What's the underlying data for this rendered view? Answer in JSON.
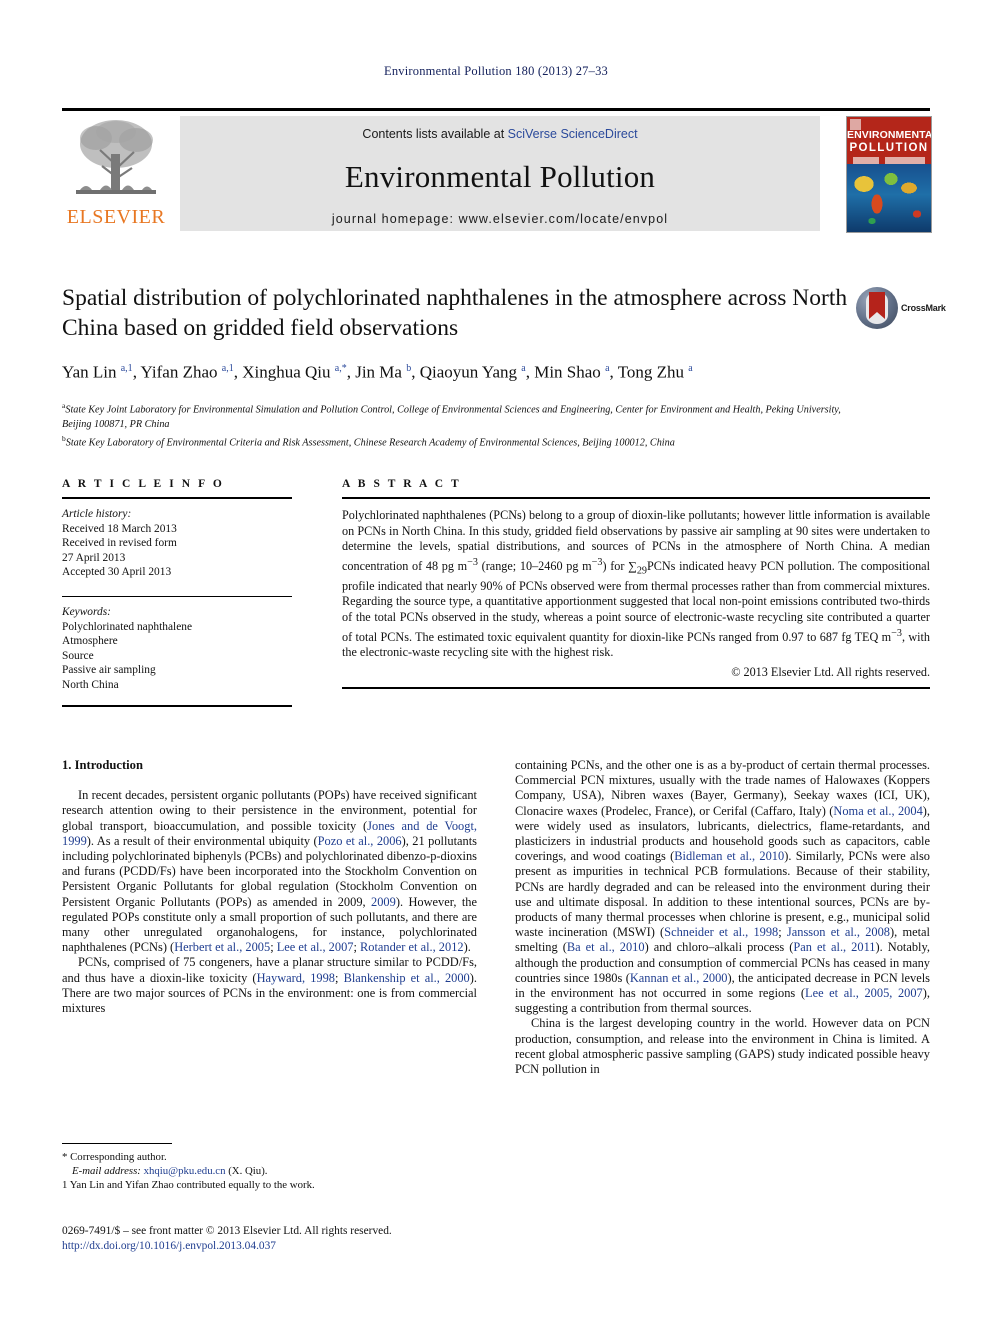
{
  "running_head": "Environmental Pollution 180 (2013) 27–33",
  "masthead": {
    "contents_prefix": "Contents lists available at ",
    "sciencedirect_link": "SciVerse ScienceDirect",
    "journal_name": "Environmental Pollution",
    "homepage": "journal homepage: www.elsevier.com/locate/envpol",
    "publisher_logo_text": "ELSEVIER",
    "cover_title_line1": "ENVIRONMENTAL",
    "cover_title_line2": "POLLUTION"
  },
  "article": {
    "title": "Spatial distribution of polychlorinated naphthalenes in the atmosphere across North China based on gridded field observations",
    "crossmark_label": "CrossMark",
    "authors_html": "Yan Lin <sup>a,1</sup>, Yifan Zhao <sup>a,1</sup>, Xinghua Qiu <sup>a,*</sup>, Jin Ma <sup>b</sup>, Qiaoyun Yang <sup>a</sup>, Min Shao <sup>a</sup>, Tong Zhu <sup>a</sup>",
    "affiliation_a": "State Key Joint Laboratory for Environmental Simulation and Pollution Control, College of Environmental Sciences and Engineering, Center for Environment and Health, Peking University, Beijing 100871, PR China",
    "affiliation_b": "State Key Laboratory of Environmental Criteria and Risk Assessment, Chinese Research Academy of Environmental Sciences, Beijing 100012, China"
  },
  "article_info": {
    "heading": "A R T I C L E    I N F O",
    "history_label": "Article history:",
    "history_lines": [
      "Received 18 March 2013",
      "Received in revised form",
      "27 April 2013",
      "Accepted 30 April 2013"
    ],
    "keywords_label": "Keywords:",
    "keywords": [
      "Polychlorinated naphthalene",
      "Atmosphere",
      "Source",
      "Passive air sampling",
      "North China"
    ]
  },
  "abstract": {
    "heading": "A B S T R A C T",
    "text_html": "Polychlorinated naphthalenes (PCNs) belong to a group of dioxin-like pollutants; however little information is available on PCNs in North China. In this study, gridded field observations by passive air sampling at 90 sites were undertaken to determine the levels, spatial distributions, and sources of PCNs in the atmosphere of North China. A median concentration of 48 pg m<sup>&minus;3</sup> (range; 10&ndash;2460 pg m<sup>&minus;3</sup>) for &sum;<sub>29</sub>PCNs indicated heavy PCN pollution. The compositional profile indicated that nearly 90% of PCNs observed were from thermal processes rather than from commercial mixtures. Regarding the source type, a quantitative apportionment suggested that local non-point emissions contributed two-thirds of the total PCNs observed in the study, whereas a point source of electronic-waste recycling site contributed a quarter of total PCNs. The estimated toxic equivalent quantity for dioxin-like PCNs ranged from 0.97 to 687 fg TEQ m<sup>&minus;3</sup>, with the electronic-waste recycling site with the highest risk.",
    "copyright": "© 2013 Elsevier Ltd. All rights reserved."
  },
  "introduction": {
    "section_title": "1.  Introduction",
    "left_paragraphs_html": [
      "In recent decades, persistent organic pollutants (POPs) have received significant research attention owing to their persistence in the environment, potential for global transport, bioaccumulation, and possible toxicity (<span class=\"ref\">Jones and de Voogt, 1999</span>). As a result of their environmental ubiquity (<span class=\"ref\">Pozo et al., 2006</span>), 21 pollutants including polychlorinated biphenyls (PCBs) and polychlorinated dibenzo-p-dioxins and furans (PCDD/Fs) have been incorporated into the Stockholm Convention on Persistent Organic Pollutants for global regulation (Stockholm Convention on Persistent Organic Pollutants (POPs) as amended in 2009, <span class=\"ref\">2009</span>). However, the regulated POPs constitute only a small proportion of such pollutants, and there are many other unregulated organohalogens, for instance, polychlorinated naphthalenes (PCNs) (<span class=\"ref\">Herbert et al., 2005</span>; <span class=\"ref\">Lee et al., 2007</span>; <span class=\"ref\">Rotander et al., 2012</span>).",
      "PCNs, comprised of 75 congeners, have a planar structure similar to PCDD/Fs, and thus have a dioxin-like toxicity (<span class=\"ref\">Hayward, 1998</span>; <span class=\"ref\">Blankenship et al., 2000</span>). There are two major sources of PCNs in the environment: one is from commercial mixtures"
    ],
    "right_paragraphs_html": [
      "containing PCNs, and the other one is as a by-product of certain thermal processes. Commercial PCN mixtures, usually with the trade names of Halowaxes (Koppers Company, USA), Nibren waxes (Bayer, Germany), Seekay waxes (ICI, UK), Clonacire waxes (Prodelec, France), or Cerifal (Caffaro, Italy) (<span class=\"ref\">Noma et al., 2004</span>), were widely used as insulators, lubricants, dielectrics, flame-retardants, and plasticizers in industrial products and household goods such as capacitors, cable coverings, and wood coatings (<span class=\"ref\">Bidleman et al., 2010</span>). Similarly, PCNs were also present as impurities in technical PCB formulations. Because of their stability, PCNs are hardly degraded and can be released into the environment during their use and ultimate disposal. In addition to these intentional sources, PCNs are by-products of many thermal processes when chlorine is present, e.g., municipal solid waste incineration (MSWI) (<span class=\"ref\">Schneider et al., 1998</span>; <span class=\"ref\">Jansson et al., 2008</span>), metal smelting (<span class=\"ref\">Ba et al., 2010</span>) and chloro–alkali process (<span class=\"ref\">Pan et al., 2011</span>). Notably, although the production and consumption of commercial PCNs has ceased in many countries since 1980s (<span class=\"ref\">Kannan et al., 2000</span>), the anticipated decrease in PCN levels in the environment has not occurred in some regions (<span class=\"ref\">Lee et al., 2005, 2007</span>), suggesting a contribution from thermal sources.",
      "China is the largest developing country in the world. However data on PCN production, consumption, and release into the environment in China is limited. A recent global atmospheric passive sampling (GAPS) study indicated possible heavy PCN pollution in"
    ]
  },
  "footnotes": {
    "corresponding_author": "* Corresponding author.",
    "email_label": "E-mail address:",
    "email": "xhqiu@pku.edu.cn",
    "email_suffix": "(X. Qiu).",
    "equal_contribution": "1  Yan Lin and Yifan Zhao contributed equally to the work.",
    "issn_line": "0269-7491/$ – see front matter © 2013 Elsevier Ltd. All rights reserved.",
    "doi": "http://dx.doi.org/10.1016/j.envpol.2013.04.037"
  }
}
